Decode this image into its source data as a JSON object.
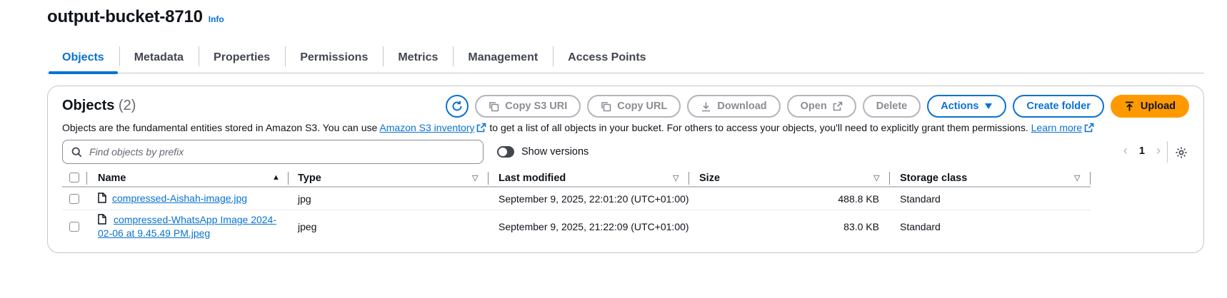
{
  "header": {
    "title": "output-bucket-8710",
    "info": "Info"
  },
  "tabs": [
    {
      "label": "Objects",
      "active": true
    },
    {
      "label": "Metadata"
    },
    {
      "label": "Properties"
    },
    {
      "label": "Permissions"
    },
    {
      "label": "Metrics"
    },
    {
      "label": "Management"
    },
    {
      "label": "Access Points"
    }
  ],
  "objects": {
    "heading": "Objects",
    "count": "(2)",
    "buttons": {
      "copy_s3_uri": "Copy S3 URI",
      "copy_url": "Copy URL",
      "download": "Download",
      "open": "Open",
      "delete": "Delete",
      "actions": "Actions",
      "create_folder": "Create folder",
      "upload": "Upload"
    },
    "description": {
      "part1": "Objects are the fundamental entities stored in Amazon S3. You can use ",
      "inventory_link": "Amazon S3 inventory",
      "part2": " to get a list of all objects in your bucket. For others to access your objects, you'll need to explicitly grant them permissions. ",
      "learn_more": "Learn more"
    },
    "search": {
      "placeholder": "Find objects by prefix",
      "value": ""
    },
    "show_versions": "Show versions",
    "pager": {
      "page": "1"
    },
    "columns": [
      "Name",
      "Type",
      "Last modified",
      "Size",
      "Storage class"
    ],
    "rows": [
      {
        "name_line1": "compressed-Aishah-image.jpg",
        "name_line2": "",
        "type": "jpg",
        "last_modified": "September 9, 2025, 22:01:20 (UTC+01:00)",
        "size": "488.8 KB",
        "storage_class": "Standard"
      },
      {
        "name_line1": "compressed-WhatsApp Image 2024-",
        "name_line2": "02-06 at 9.45.49 PM.jpeg",
        "type": "jpeg",
        "last_modified": "September 9, 2025, 21:22:09 (UTC+01:00)",
        "size": "83.0 KB",
        "storage_class": "Standard"
      }
    ]
  },
  "colors": {
    "link": "#0972d3",
    "upload": "#ff9900",
    "border": "#c6c6cd"
  }
}
